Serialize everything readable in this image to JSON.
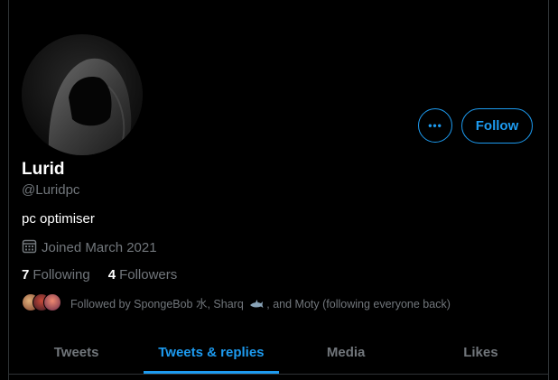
{
  "profile": {
    "name": "Lurid",
    "handle": "@Luridpc",
    "bio": "pc optimiser",
    "joined": "Joined March 2021",
    "following_count": "7",
    "following_label": "Following",
    "followers_count": "4",
    "followers_label": "Followers",
    "followed_by_prefix": "Followed by SpongeBob 水, Sharq",
    "followed_by_suffix": ", and Moty (following everyone back)"
  },
  "actions": {
    "more_label": "•••",
    "follow_label": "Follow"
  },
  "tabs": [
    {
      "label": "Tweets",
      "active": false
    },
    {
      "label": "Tweets & replies",
      "active": true
    },
    {
      "label": "Media",
      "active": false
    },
    {
      "label": "Likes",
      "active": false
    }
  ],
  "colors": {
    "accent": "#1d9bf0",
    "background": "#000000",
    "muted_text": "#71767b"
  },
  "icons": {
    "calendar": "calendar-icon",
    "more": "more-horizontal-icon",
    "shark": "shark-icon"
  }
}
